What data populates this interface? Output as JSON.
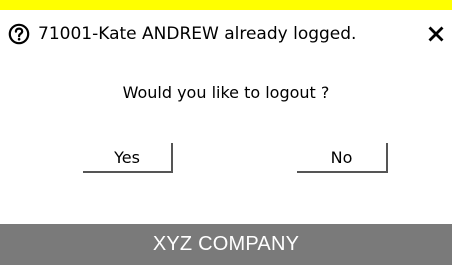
{
  "dialog": {
    "accent_color": "#ffff00",
    "icon": "question-circle-icon",
    "title": "71001-Kate ANDREW already logged.",
    "close_icon": "close-icon",
    "prompt": "Would you like to logout ?",
    "yes_label": "Yes",
    "no_label": "No"
  },
  "footer": {
    "company": "XYZ COMPANY",
    "background_color": "#7a7a7a"
  }
}
